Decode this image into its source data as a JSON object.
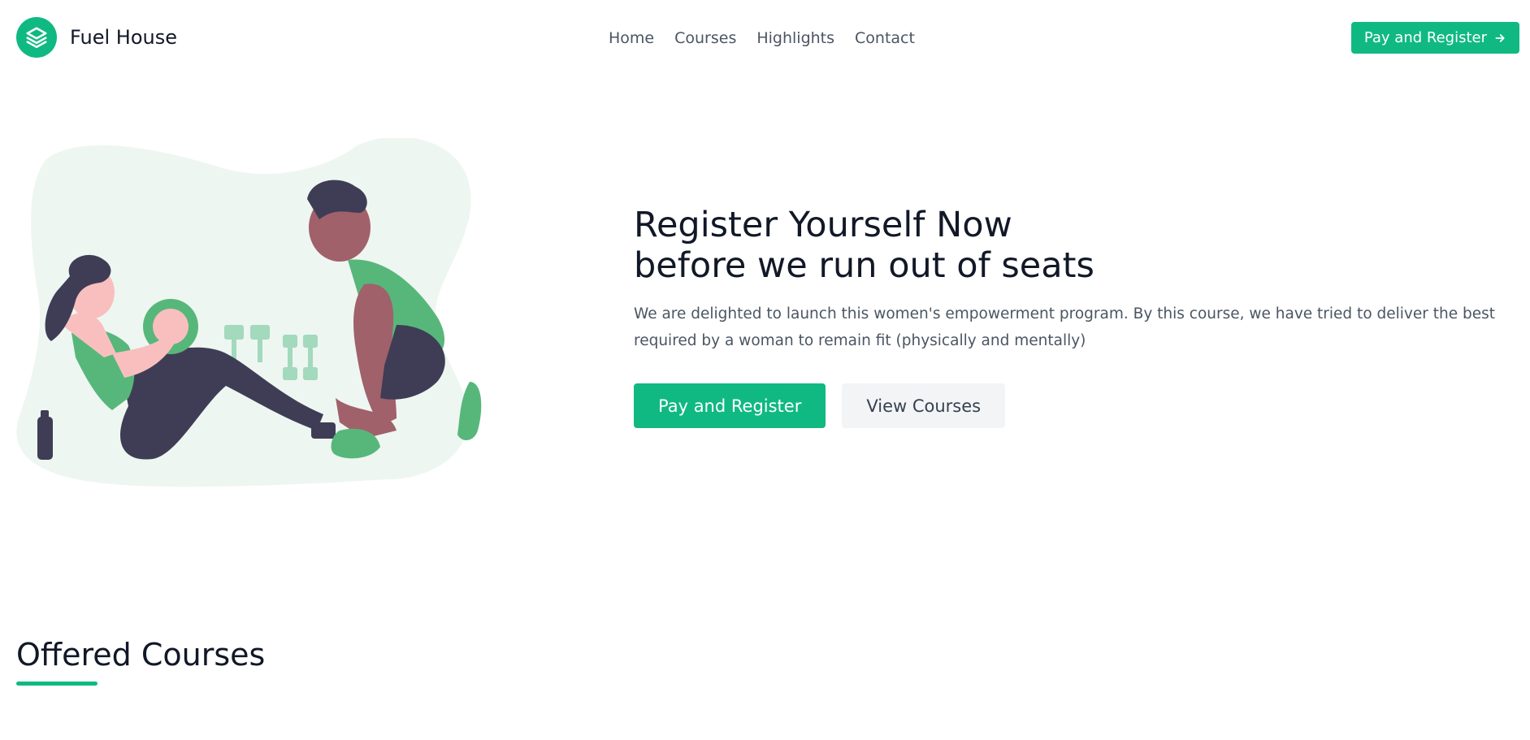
{
  "brand": {
    "name": "Fuel House",
    "logo_icon": "layers-icon",
    "accent_color": "#10b981"
  },
  "nav": {
    "items": [
      {
        "label": "Home"
      },
      {
        "label": "Courses"
      },
      {
        "label": "Highlights"
      },
      {
        "label": "Contact"
      }
    ]
  },
  "header_cta": {
    "label": "Pay and Register",
    "icon": "arrow-right-icon"
  },
  "hero": {
    "title_line1": "Register Yourself Now",
    "title_line2": "before we run out of seats",
    "description": "We are delighted to launch this women's empowerment program. By this course, we have tried to deliver the best required by a woman to remain fit (physically and mentally)",
    "primary_button": "Pay and Register",
    "secondary_button": "View Courses"
  },
  "section": {
    "title": "Offered Courses"
  }
}
